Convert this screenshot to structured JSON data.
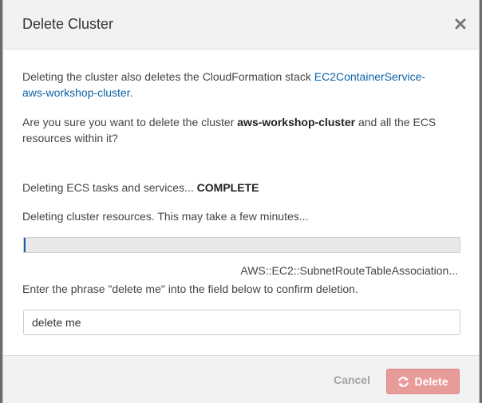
{
  "dialog": {
    "title": "Delete Cluster",
    "close_symbol": "×"
  },
  "body": {
    "intro_text": "Deleting the cluster also deletes the CloudFormation stack ",
    "stack_link": "EC2ContainerService-aws-workshop-cluster",
    "intro_end": ".",
    "confirm_question_prefix": "Are you sure you want to delete the cluster ",
    "cluster_name": "aws-workshop-cluster",
    "confirm_question_suffix": " and all the ECS resources within it?",
    "tasks_status_prefix": "Deleting ECS tasks and services... ",
    "tasks_status_value": "COMPLETE",
    "resources_status": "Deleting cluster resources. This may take a few minutes...",
    "progress_fraction": 0.004,
    "current_resource": "AWS::EC2::SubnetRouteTableAssociation...",
    "phrase_instruction": "Enter the phrase \"delete me\" into the field below to confirm deletion.",
    "confirm_input_value": "delete me"
  },
  "footer": {
    "cancel_label": "Cancel",
    "delete_label": "Delete"
  },
  "colors": {
    "link": "#0b62a4",
    "progress_fill": "#1a5fa8",
    "delete_button": "#e89c9a",
    "header_bg": "#f2f2f2"
  },
  "icons": {
    "close": "close-icon",
    "delete_spinner": "refresh-spinner-icon"
  }
}
